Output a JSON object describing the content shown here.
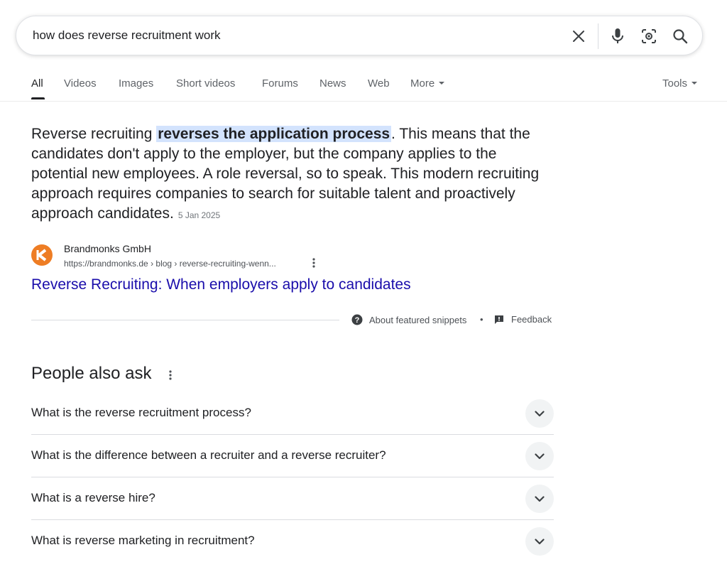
{
  "search": {
    "query": "how does reverse recruitment work",
    "icons": [
      "close-icon",
      "microphone-icon",
      "lens-icon",
      "search-icon"
    ]
  },
  "tabs": {
    "items": [
      "All",
      "Videos",
      "Images",
      "Short videos",
      "Forums",
      "News",
      "Web",
      "More"
    ],
    "active": "All",
    "tools": "Tools"
  },
  "snippet": {
    "text_before": "Reverse recruiting ",
    "highlight": "reverses the application process",
    "text_after": ". This means that the candidates don't apply to the employer, but the company applies to the potential new employees. A role reversal, so to speak. This modern recruiting approach requires companies to search for suitable talent and proactively approach candidates.",
    "date": "5 Jan 2025",
    "source_name": "Brandmonks GmbH",
    "source_url": "https://brandmonks.de › blog › reverse-recruiting-wenn...",
    "link_title": "Reverse Recruiting: When employers apply to candidates",
    "about_label": "About featured snippets",
    "separator": "•",
    "feedback_label": "Feedback",
    "accent_link_color": "#1a0dab",
    "highlight_color": "#d3e3fd",
    "favicon_color": "#ee7d24"
  },
  "paa": {
    "title": "People also ask",
    "questions": [
      "What is the reverse recruitment process?",
      "What is the difference between a recruiter and a reverse recruiter?",
      "What is a reverse hire?",
      "What is reverse marketing in recruitment?"
    ]
  }
}
